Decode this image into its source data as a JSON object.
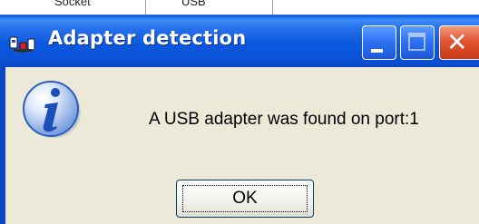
{
  "background_window": {
    "cell_1": "Socket",
    "cell_2": "USB"
  },
  "dialog": {
    "title": "Adapter detection",
    "message": "A USB adapter was found on port:1",
    "ok_label": "OK",
    "icon": "info-icon",
    "app_icon": "adapter-app-icon"
  },
  "titlebar_buttons": {
    "minimize_icon": "minimize-icon",
    "maximize_icon": "maximize-icon",
    "close_icon": "close-icon"
  },
  "colors": {
    "titlebar": "#0a53d8",
    "close_button": "#e25531",
    "client_background": "#ece9d8"
  }
}
